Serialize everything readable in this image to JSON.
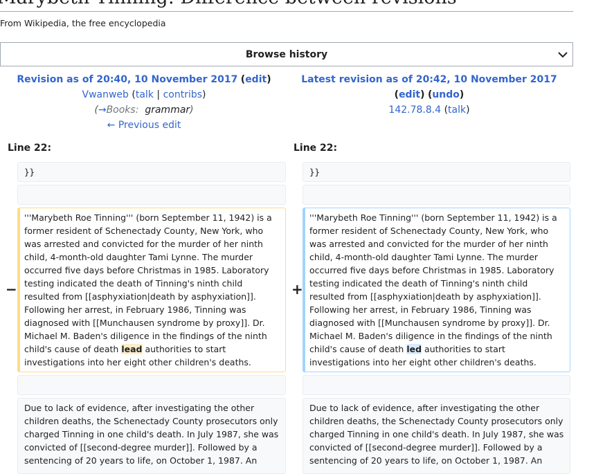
{
  "page": {
    "title": "Marybeth Tinning: Difference between revisions",
    "tagline": "From Wikipedia, the free encyclopedia"
  },
  "browse_history": {
    "label": "Browse history",
    "icon": "chevron-down-icon"
  },
  "left_header": {
    "revision_label": "Revision as of 20:40, 10 November 2017",
    "edit_label": "edit",
    "user": "Vwanweb",
    "talk_label": "talk",
    "contribs_label": "contribs",
    "summary_arrow": "→",
    "summary_section": "Books:",
    "summary_text": "grammar",
    "prev_edit": "← Previous edit"
  },
  "right_header": {
    "revision_label": "Latest revision as of 20:42, 10 November 2017",
    "edit_label": "edit",
    "undo_label": "undo",
    "user": "142.78.8.4",
    "talk_label": "talk"
  },
  "diff": {
    "left_line_label": "Line 22:",
    "right_line_label": "Line 22:",
    "context_line": "}}",
    "removed_marker": "−",
    "added_marker": "+",
    "para_before": "'''Marybeth Roe Tinning''' (born September 11, 1942) is a former resident of Schenectady County, New York, who was arrested and convicted for the murder of her ninth child, 4-month-old daughter Tami Lynne. The murder occurred five days before Christmas in 1985. Laboratory testing indicated the death of Tinning's ninth child resulted from [[asphyxiation|death by asphyxiation]].  Following her arrest, in February 1986, Tinning was diagnosed with [[Munchausen syndrome by proxy]].  Dr. Michael M. Baden's diligence in the findings of the ninth child's cause of death ",
    "removed_word": "lead",
    "added_word": "led",
    "para_after": " authorities to start investigations into her eight other children's deaths.",
    "next_para": "Due to lack of evidence, after investigating the other children deaths, the Schenectady County prosecutors only charged Tinning in one child's death.  In July 1987, she was convicted of [[second-degree murder]].  Followed by a sentencing of 20 years to life, on October 1, 1987. An"
  }
}
